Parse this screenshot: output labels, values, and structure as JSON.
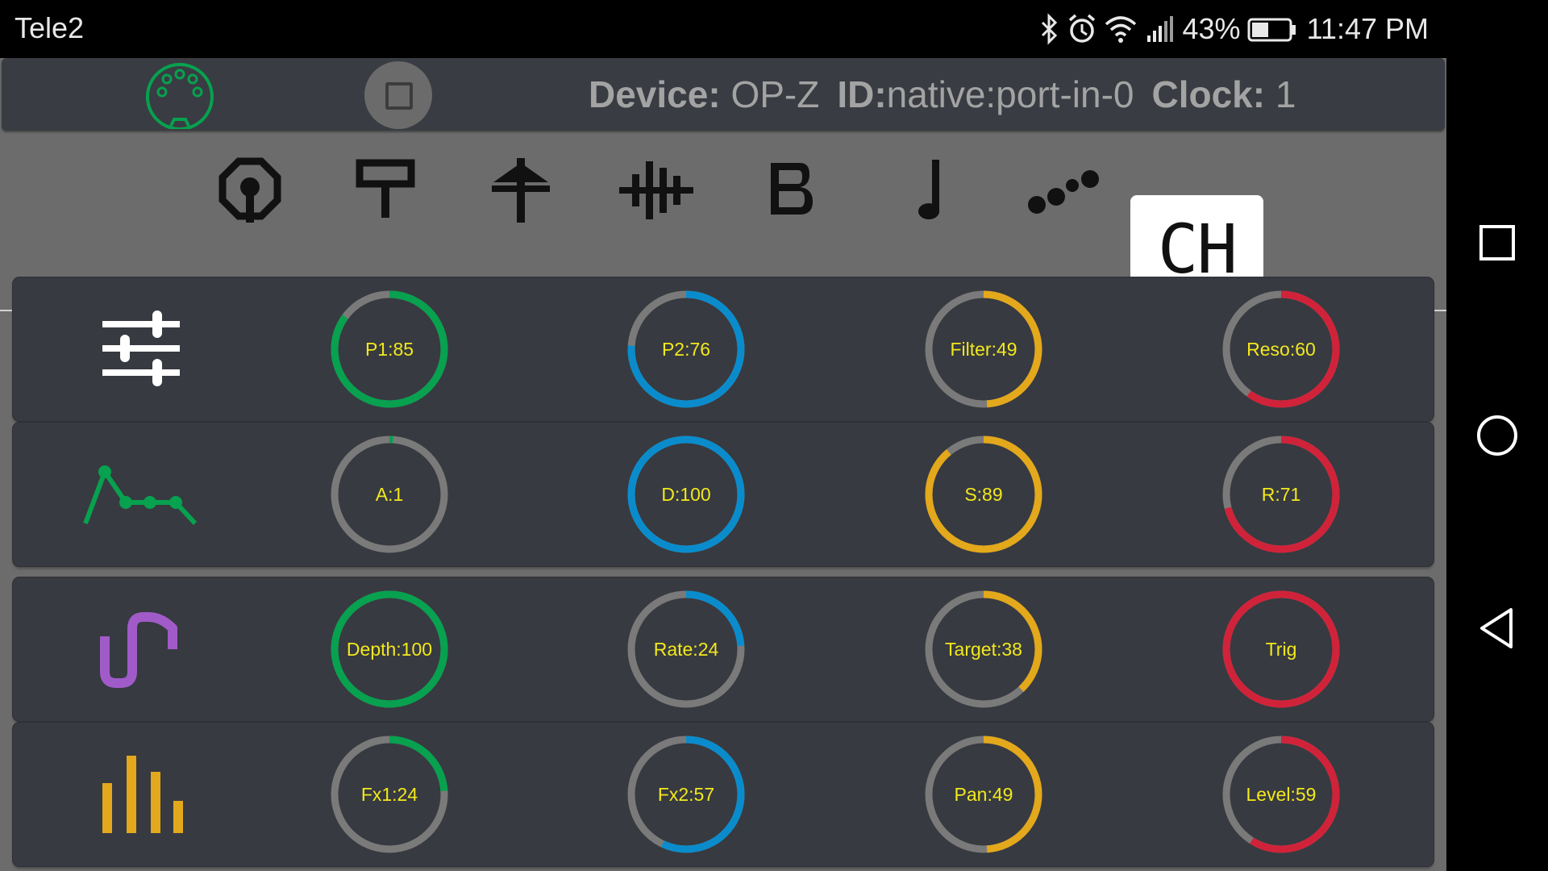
{
  "status_bar": {
    "carrier": "Tele2",
    "battery": "43%",
    "time": "11:47 PM",
    "icons": [
      "bluetooth-icon",
      "alarm-icon",
      "wifi-icon",
      "signal-icon",
      "battery-icon"
    ]
  },
  "header": {
    "midi_icon": "midi-connector-icon",
    "stop_icon": "stop-icon",
    "device_label": "Device:",
    "device_value": "OP-Z",
    "id_label": "ID:",
    "id_value": "native:port-in-0",
    "clock_label": "Clock:",
    "clock_value": "1"
  },
  "tabs": [
    {
      "icon": "kick-icon"
    },
    {
      "icon": "snare-icon"
    },
    {
      "icon": "cymbal-icon"
    },
    {
      "icon": "sample-icon"
    },
    {
      "icon": "bass-icon"
    },
    {
      "icon": "note-icon"
    },
    {
      "icon": "arpeggio-icon"
    },
    {
      "label": "CH",
      "active": true
    }
  ],
  "colors": {
    "green": "#07a14f",
    "blue": "#0a8ccc",
    "yellow": "#e3a81b",
    "red": "#d0233a",
    "track": "#7a7a7a",
    "knob_text": "#f2e81c",
    "lfo_icon": "#a05bc9"
  },
  "rows": [
    {
      "icon": "sliders-icon",
      "knobs": [
        {
          "label": "P1:85",
          "value": 85,
          "color": "green"
        },
        {
          "label": "P2:76",
          "value": 76,
          "color": "blue"
        },
        {
          "label": "Filter:49",
          "value": 49,
          "color": "yellow"
        },
        {
          "label": "Reso:60",
          "value": 60,
          "color": "red"
        }
      ]
    },
    {
      "icon": "envelope-icon",
      "knobs": [
        {
          "label": "A:1",
          "value": 1,
          "color": "green"
        },
        {
          "label": "D:100",
          "value": 100,
          "color": "blue"
        },
        {
          "label": "S:89",
          "value": 89,
          "color": "yellow"
        },
        {
          "label": "R:71",
          "value": 71,
          "color": "red"
        }
      ]
    },
    {
      "icon": "lfo-wave-icon",
      "knobs": [
        {
          "label": "Depth:100",
          "value": 100,
          "color": "green"
        },
        {
          "label": "Rate:24",
          "value": 24,
          "color": "blue"
        },
        {
          "label": "Target:38",
          "value": 38,
          "color": "yellow"
        },
        {
          "label": "Trig",
          "value": 100,
          "color": "red"
        }
      ]
    },
    {
      "icon": "levels-icon",
      "knobs": [
        {
          "label": "Fx1:24",
          "value": 24,
          "color": "green"
        },
        {
          "label": "Fx2:57",
          "value": 57,
          "color": "blue"
        },
        {
          "label": "Pan:49",
          "value": 49,
          "color": "yellow"
        },
        {
          "label": "Level:59",
          "value": 59,
          "color": "red"
        }
      ]
    }
  ],
  "nav": {
    "recents": "square-recents-icon",
    "home": "circle-home-icon",
    "back": "triangle-back-icon"
  }
}
